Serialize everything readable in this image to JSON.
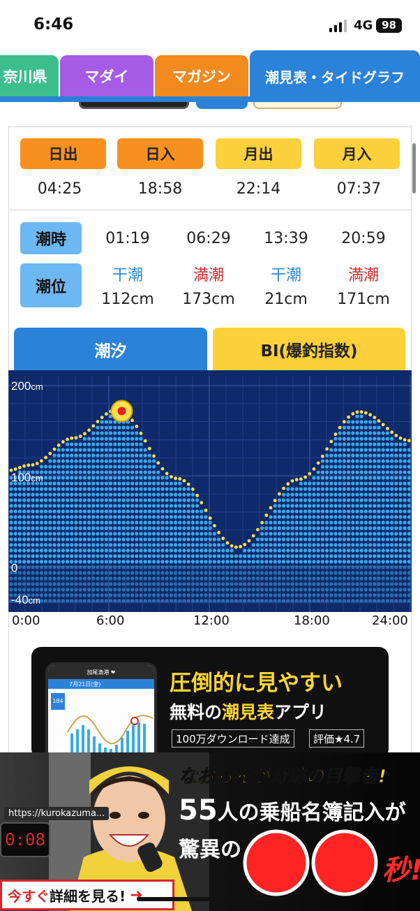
{
  "status": {
    "time": "6:46",
    "network": "4G",
    "battery": "98"
  },
  "tabs": [
    {
      "label": "奈川県",
      "color": "#3cbf8d"
    },
    {
      "label": "マダイ",
      "color": "#a65be6"
    },
    {
      "label": "マガジン",
      "color": "#f28a1e"
    },
    {
      "label": "潮見表・タイドグラフ",
      "color": "#2b82d9",
      "active": true
    }
  ],
  "sun_moon": [
    {
      "label": "日出",
      "time": "04:25",
      "color": "#f7901f"
    },
    {
      "label": "日入",
      "time": "18:58",
      "color": "#f7901f"
    },
    {
      "label": "月出",
      "time": "22:14",
      "color": "#fcd03a"
    },
    {
      "label": "月入",
      "time": "07:37",
      "color": "#fcd03a"
    }
  ],
  "tide": {
    "time_label": "潮時",
    "level_label": "潮位",
    "entries": [
      {
        "time": "01:19",
        "type": "干潮",
        "level": "112cm",
        "color": "#2b8ad8"
      },
      {
        "time": "06:29",
        "type": "満潮",
        "level": "173cm",
        "color": "#d22a2a"
      },
      {
        "time": "13:39",
        "type": "干潮",
        "level": "21cm",
        "color": "#2b8ad8"
      },
      {
        "time": "20:59",
        "type": "満潮",
        "level": "171cm",
        "color": "#d22a2a"
      }
    ]
  },
  "chart_tabs": {
    "tide": "潮汐",
    "bi": "BI(爆釣指数)"
  },
  "chart_data": {
    "type": "area",
    "x_unit": "hours",
    "x": [
      0,
      1.32,
      3.9,
      6.48,
      10.1,
      13.65,
      17.3,
      20.98,
      24
    ],
    "values": [
      106,
      112,
      142,
      173,
      97,
      21,
      96,
      171,
      139
    ],
    "ylim": [
      -40,
      200
    ],
    "xlim": [
      0,
      24
    ],
    "y_ticks": [
      "200cm",
      "100cm",
      "0",
      "-40cm"
    ],
    "y_tick_values": [
      200,
      100,
      0,
      -40
    ],
    "x_ticks": [
      "0:00",
      "6:00",
      "12:00",
      "18:00",
      "24:00"
    ],
    "x_tick_values": [
      0,
      6,
      12,
      18,
      24
    ],
    "current_hour": 6.77,
    "grid": true,
    "bg_color": "#0f2a6b",
    "fill_color": "#3aa9e8",
    "line_color": "#ffe14a"
  },
  "app_ad": {
    "headline": "圧倒的に見やすい",
    "sub_prefix": "無料の",
    "sub_highlight": "潮見表",
    "sub_suffix": "アプリ",
    "badge1": "100万ダウンロード達成",
    "badge2": "評価★4.7",
    "phone_title": "加尾漁港 ❤",
    "phone_date": "7月21日(金)",
    "phone_level": "184"
  },
  "banner": {
    "url": "https://kurokazuma...",
    "timer": "0:08",
    "line1": "なおちんが奇跡の目撃者!",
    "count": "55",
    "line2": "人の乗船名簿記入が",
    "line3": "驚異の",
    "seconds": "秒!",
    "cta_prefix": "今すぐ",
    "cta_main": "詳細を見る!"
  }
}
